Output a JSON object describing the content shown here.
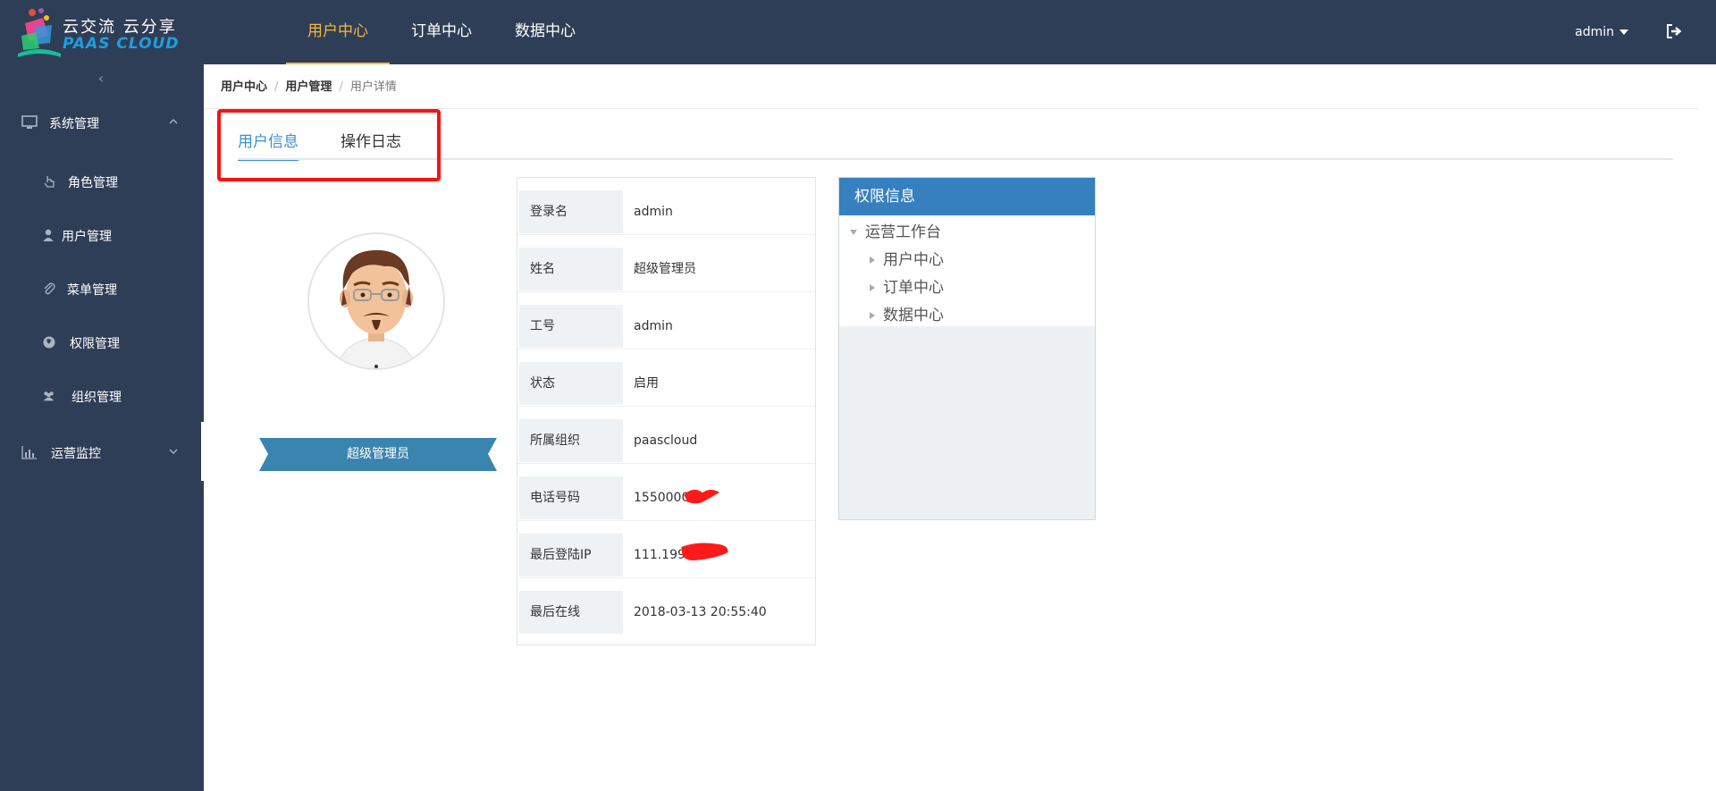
{
  "header": {
    "logo_line1": "云交流 云分享",
    "logo_line2": "PAAS CLOUD",
    "nav": [
      {
        "label": "用户中心",
        "active": true
      },
      {
        "label": "订单中心",
        "active": false
      },
      {
        "label": "数据中心",
        "active": false
      }
    ],
    "user": "admin"
  },
  "sidebar": {
    "groups": [
      {
        "label": "系统管理",
        "icon": "monitor-icon",
        "expanded": true
      },
      {
        "label": "运营监控",
        "icon": "bar-chart-icon",
        "expanded": false
      }
    ],
    "items": [
      {
        "label": "角色管理",
        "icon": "hand-pointer-icon"
      },
      {
        "label": "用户管理",
        "icon": "user-icon"
      },
      {
        "label": "菜单管理",
        "icon": "paperclip-icon"
      },
      {
        "label": "权限管理",
        "icon": "firefox-icon"
      },
      {
        "label": "组织管理",
        "icon": "users-icon"
      }
    ]
  },
  "breadcrumb": [
    "用户中心",
    "用户管理",
    "用户详情"
  ],
  "tabs": [
    {
      "label": "用户信息",
      "active": true
    },
    {
      "label": "操作日志",
      "active": false
    }
  ],
  "profile": {
    "role_badge": "超级管理员"
  },
  "info": [
    {
      "label": "登录名",
      "value": "admin"
    },
    {
      "label": "姓名",
      "value": "超级管理员"
    },
    {
      "label": "工号",
      "value": "admin"
    },
    {
      "label": "状态",
      "value": "启用"
    },
    {
      "label": "所属组织",
      "value": "paascloud"
    },
    {
      "label": "电话号码",
      "value": "1550000"
    },
    {
      "label": "最后登陆IP",
      "value": "111.199."
    },
    {
      "label": "最后在线",
      "value": "2018-03-13 20:55:40"
    }
  ],
  "permissions": {
    "title": "权限信息",
    "root": "运营工作台",
    "children": [
      "用户中心",
      "订单中心",
      "数据中心"
    ]
  },
  "colors": {
    "header_bg": "#2f3e57",
    "accent_nav": "#f6b93b",
    "tab_active": "#3d8fd6",
    "perm_header": "#3780bf",
    "ribbon": "#3a85b0",
    "highlight_box": "#ff1010"
  }
}
